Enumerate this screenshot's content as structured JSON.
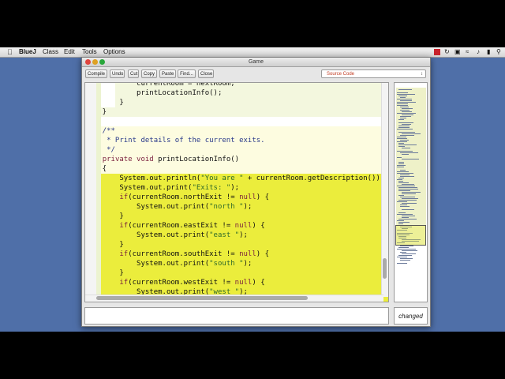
{
  "menubar": {
    "app": "BlueJ",
    "items": [
      "Class",
      "Edit",
      "Tools",
      "Options"
    ]
  },
  "window": {
    "title": "Game"
  },
  "toolbar": {
    "buttons": [
      "Compile",
      "Undo",
      "Cut",
      "Copy",
      "Paste",
      "Find...",
      "Close"
    ],
    "view_selector": "Source Code"
  },
  "code": {
    "lines": [
      "            currentRoom = nextRoom;",
      "            printLocationInfo();",
      "        }",
      "    }",
      "",
      "    /**",
      "     * Print details of the current exits.",
      "     */",
      "    private void printLocationInfo()",
      "    {",
      "        System.out.println(\"You are \" + currentRoom.getDescription());",
      "        System.out.print(\"Exits: \");",
      "        if(currentRoom.northExit != null) {",
      "            System.out.print(\"north \");",
      "        }",
      "        if(currentRoom.eastExit != null) {",
      "            System.out.print(\"east \");",
      "        }",
      "        if(currentRoom.southExit != null) {",
      "            System.out.print(\"south \");",
      "        }",
      "        if(currentRoom.westExit != null) {",
      "            System.out.print(\"west \");",
      "        }"
    ]
  },
  "status": {
    "message": "",
    "state": "changed"
  },
  "colors": {
    "selection": "#ebed3c",
    "desktop": "#4f6fa8",
    "keyword": "#7a1f3d",
    "string": "#2f6a2a"
  }
}
